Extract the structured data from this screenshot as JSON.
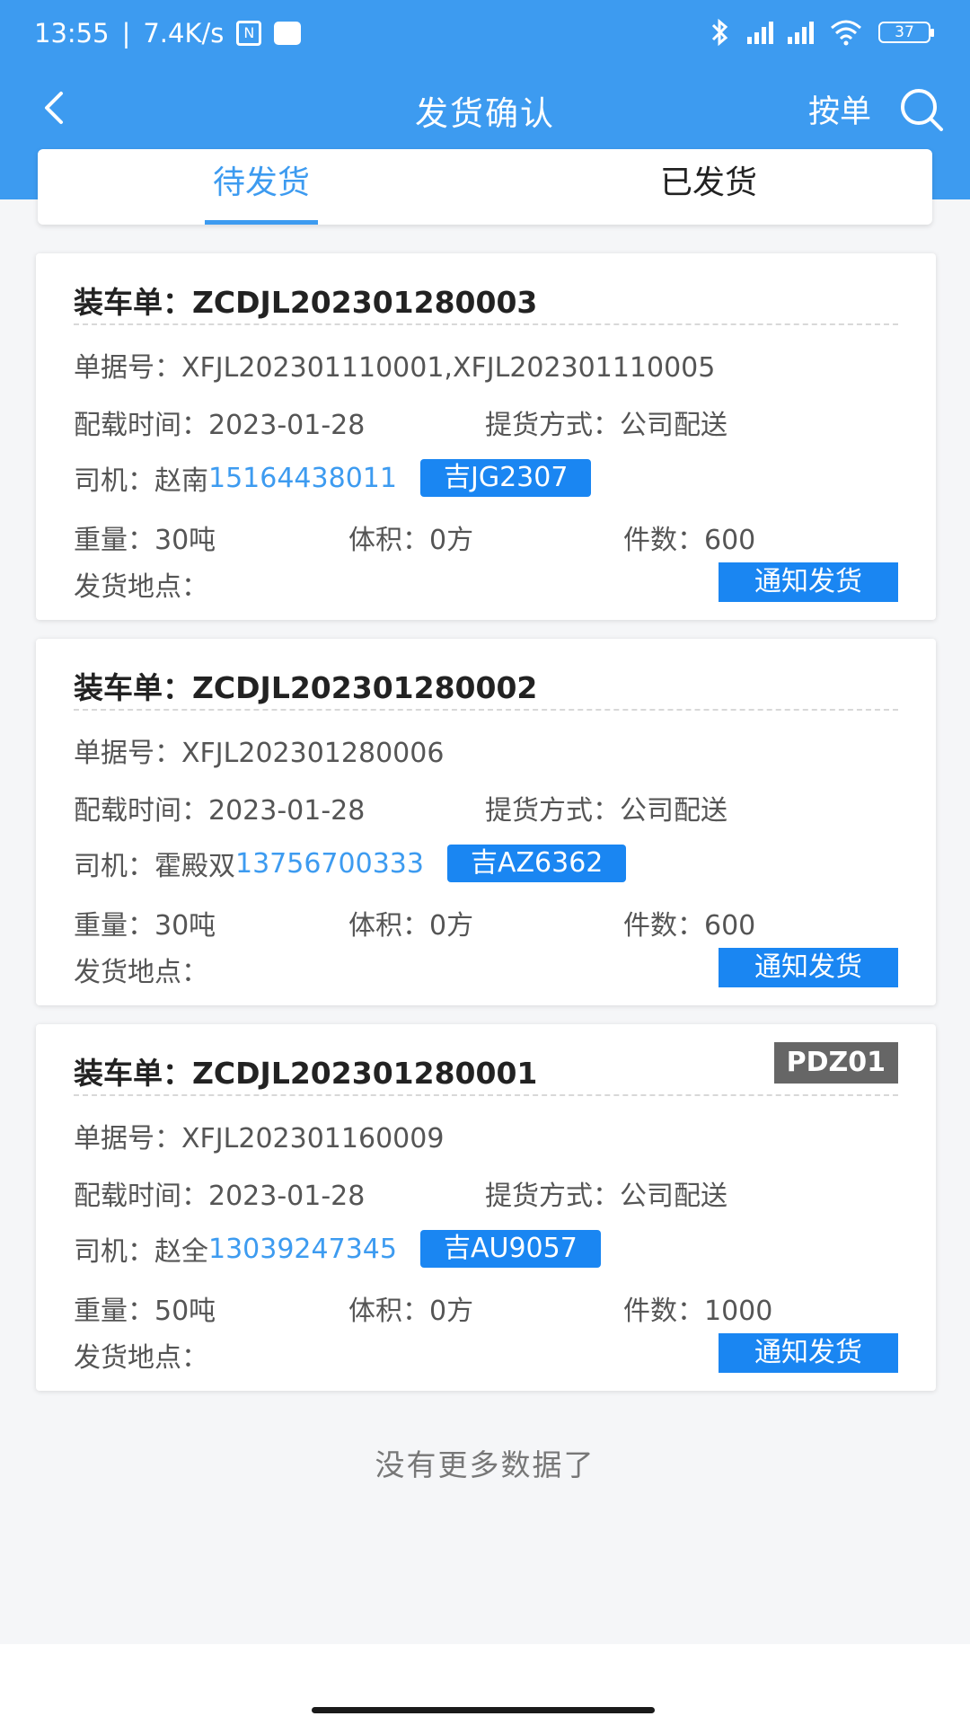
{
  "status": {
    "time": "13:55",
    "speed": "7.4K/s",
    "battery": "37"
  },
  "nav": {
    "title": "发货确认",
    "action_label": "按单",
    "back_icon": "chevron-left-icon",
    "search_icon": "search-icon"
  },
  "tabs": [
    {
      "label": "待发货",
      "active": true
    },
    {
      "label": "已发货",
      "active": false
    }
  ],
  "cards": [
    {
      "title_label": "装车单：",
      "title_value": "ZCDJL202301280003",
      "tag": "",
      "doc_label": "单据号：",
      "doc_value": "XFJL202301110001,XFJL202301110005",
      "time_label": "配载时间：",
      "time_value": "2023-01-28",
      "pickup_label": "提货方式：",
      "pickup_value": "公司配送",
      "driver_label": "司机：",
      "driver_name": "赵南",
      "driver_phone": "15164438011",
      "plate": "吉JG2307",
      "weight": "重量：30吨",
      "volume": "体积：0方",
      "pieces": "件数：600",
      "location_label": "发货地点：",
      "button_label": "通知发货"
    },
    {
      "title_label": "装车单：",
      "title_value": "ZCDJL202301280002",
      "tag": "",
      "doc_label": "单据号：",
      "doc_value": "XFJL202301280006",
      "time_label": "配载时间：",
      "time_value": "2023-01-28",
      "pickup_label": "提货方式：",
      "pickup_value": "公司配送",
      "driver_label": "司机：",
      "driver_name": "霍殿双",
      "driver_phone": "13756700333",
      "plate": "吉AZ6362",
      "weight": "重量：30吨",
      "volume": "体积：0方",
      "pieces": "件数：600",
      "location_label": "发货地点：",
      "button_label": "通知发货"
    },
    {
      "title_label": "装车单：",
      "title_value": "ZCDJL202301280001",
      "tag": "PDZ01",
      "doc_label": "单据号：",
      "doc_value": "XFJL202301160009",
      "time_label": "配载时间：",
      "time_value": "2023-01-28",
      "pickup_label": "提货方式：",
      "pickup_value": "公司配送",
      "driver_label": "司机：",
      "driver_name": "赵全",
      "driver_phone": "13039247345",
      "plate": "吉AU9057",
      "weight": "重量：50吨",
      "volume": "体积：0方",
      "pieces": "件数：1000",
      "location_label": "发货地点：",
      "button_label": "通知发货"
    }
  ],
  "footer": {
    "no_more": "没有更多数据了"
  },
  "colors": {
    "primary": "#3d9bf0",
    "button": "#1a86f2",
    "tag_gray": "#666666"
  }
}
